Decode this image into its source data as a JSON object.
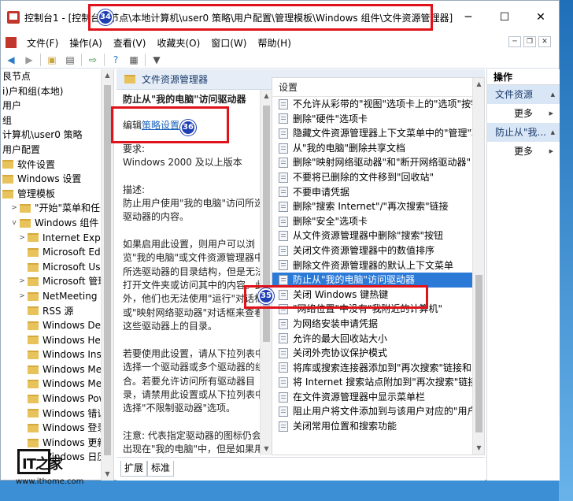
{
  "window": {
    "title": "控制台1 - [控制台根节点\\本地计算机\\user0 策略\\用户配置\\管理模板\\Windows 组件\\文件资源管理器]",
    "minimize": "─",
    "maximize": "☐",
    "close": "✕"
  },
  "menubar": {
    "items": [
      "文件(F)",
      "操作(A)",
      "查看(V)",
      "收藏夹(O)",
      "窗口(W)",
      "帮助(H)"
    ]
  },
  "toolbar": {
    "icons": [
      "back-arrow-icon",
      "forward-arrow-icon",
      "folder-up-icon",
      "show-tree-icon",
      "export-icon",
      "help-icon",
      "properties-icon",
      "filter-icon"
    ]
  },
  "tree": {
    "items": [
      {
        "label": "艮节点",
        "indent": 0,
        "folder": false,
        "expander": ""
      },
      {
        "label": "i)户和组(本地)",
        "indent": 0,
        "folder": false,
        "expander": ""
      },
      {
        "label": "用户",
        "indent": 0,
        "folder": false,
        "expander": ""
      },
      {
        "label": "组",
        "indent": 0,
        "folder": false,
        "expander": ""
      },
      {
        "label": "计算机\\user0 策略",
        "indent": 0,
        "folder": false,
        "expander": ""
      },
      {
        "label": "用户配置",
        "indent": 0,
        "folder": false,
        "expander": ""
      },
      {
        "label": "软件设置",
        "indent": 0,
        "folder": true,
        "expander": ""
      },
      {
        "label": "Windows 设置",
        "indent": 0,
        "folder": true,
        "expander": ""
      },
      {
        "label": "管理模板",
        "indent": 0,
        "folder": true,
        "expander": ""
      },
      {
        "label": "\"开始\"菜单和任务",
        "indent": 1,
        "folder": true,
        "expander": ">"
      },
      {
        "label": "Windows 组件",
        "indent": 1,
        "folder": true,
        "expander": "v"
      },
      {
        "label": "Internet Explo",
        "indent": 2,
        "folder": true,
        "expander": ">"
      },
      {
        "label": "Microsoft Edg",
        "indent": 2,
        "folder": true,
        "expander": ""
      },
      {
        "label": "Microsoft Use",
        "indent": 2,
        "folder": true,
        "expander": ""
      },
      {
        "label": "Microsoft 管理",
        "indent": 2,
        "folder": true,
        "expander": ">"
      },
      {
        "label": "NetMeeting",
        "indent": 2,
        "folder": true,
        "expander": ">"
      },
      {
        "label": "RSS 源",
        "indent": 2,
        "folder": true,
        "expander": ""
      },
      {
        "label": "Windows Defe",
        "indent": 2,
        "folder": true,
        "expander": ""
      },
      {
        "label": "Windows Hell",
        "indent": 2,
        "folder": true,
        "expander": ""
      },
      {
        "label": "Windows Inst",
        "indent": 2,
        "folder": true,
        "expander": ""
      },
      {
        "label": "Windows Med",
        "indent": 2,
        "folder": true,
        "expander": ""
      },
      {
        "label": "Windows Mes",
        "indent": 2,
        "folder": true,
        "expander": ""
      },
      {
        "label": "Windows Pow",
        "indent": 2,
        "folder": true,
        "expander": ""
      },
      {
        "label": "Windows 错误",
        "indent": 2,
        "folder": true,
        "expander": ""
      },
      {
        "label": "Windows 登录",
        "indent": 2,
        "folder": true,
        "expander": ""
      },
      {
        "label": "Windows 更新",
        "indent": 2,
        "folder": true,
        "expander": ""
      },
      {
        "label": "Windows 日历",
        "indent": 2,
        "folder": true,
        "expander": ""
      }
    ]
  },
  "main": {
    "header": "文件资源管理器",
    "policy_title": "防止从\"我的电脑\"访问驱动器",
    "edit_prefix": "编辑",
    "edit_link": "策略设置",
    "requirement_label": "要求:",
    "requirement_value": "Windows 2000 及以上版本",
    "description_label": "描述:",
    "description": "防止用户使用\"我的电脑\"访问所选驱动器的内容。",
    "paragraph1": "如果启用此设置，则用户可以浏览\"我的电脑\"或文件资源管理器中所选驱动器的目录结构，但是无法打开文件夹或访问其中的内容。此外，他们也无法使用\"运行\"对话框或\"映射网络驱动器\"对话框来查看这些驱动器上的目录。",
    "paragraph2": "若要使用此设置，请从下拉列表中选择一个驱动器或多个驱动器的组合。若要允许访问所有驱动器目录，请禁用此设置或从下拉列表中选择\"不限制驱动器\"选项。",
    "paragraph3": "注意: 代表指定驱动器的图标仍会出现在\"我的电脑\"中，但是如果用户双击这些图标，则会出现一条消息来解释设置防止这一操作。",
    "list_header": "设置",
    "settings": [
      "不允许从彩带的\"视图\"选项卡上的\"选项\"按钮中打开",
      "删除\"硬件\"选项卡",
      "隐藏文件资源管理器上下文菜单中的\"管理\"项目",
      "从\"我的电脑\"删除共享文档",
      "删除\"映射网络驱动器\"和\"断开网络驱动器\"",
      "不要将已删除的文件移到\"回收站\"",
      "不要申请凭据",
      "删除\"搜索 Internet\"/\"再次搜索\"链接",
      "删除\"安全\"选项卡",
      "从文件资源管理器中删除\"搜索\"按钮",
      "关闭文件资源管理器中的数值排序",
      "删除文件资源管理器的默认上下文菜单",
      "防止从\"我的电脑\"访问驱动器",
      "关闭 Windows 键热键",
      "\"网络位置\"中没有\"我附近的计算机\"",
      "为网络安装申请凭据",
      "允许的最大回收站大小",
      "关闭外壳协议保护模式",
      "将库或搜索连接器添加到\"再次搜索\"链接和\"开始\"",
      "将 Internet 搜索站点附加到\"再次搜索\"链接和\"开始\"",
      "在文件资源管理器中显示菜单栏",
      "阻止用户将文件添加到与该用户对应的\"用户文件",
      "关闭常用位置和搜索功能"
    ],
    "selected_index": 12,
    "tabs": [
      "扩展",
      "标准"
    ]
  },
  "actions": {
    "title": "操作",
    "section1": "文件资源",
    "more1": "更多",
    "section2": "防止从\"我...",
    "more2": "更多"
  },
  "annotations": {
    "badge_title": "34",
    "badge_edit": "36",
    "badge_item": "35"
  },
  "watermark": {
    "logo": "IT之家",
    "url": "www.ithome.com"
  }
}
